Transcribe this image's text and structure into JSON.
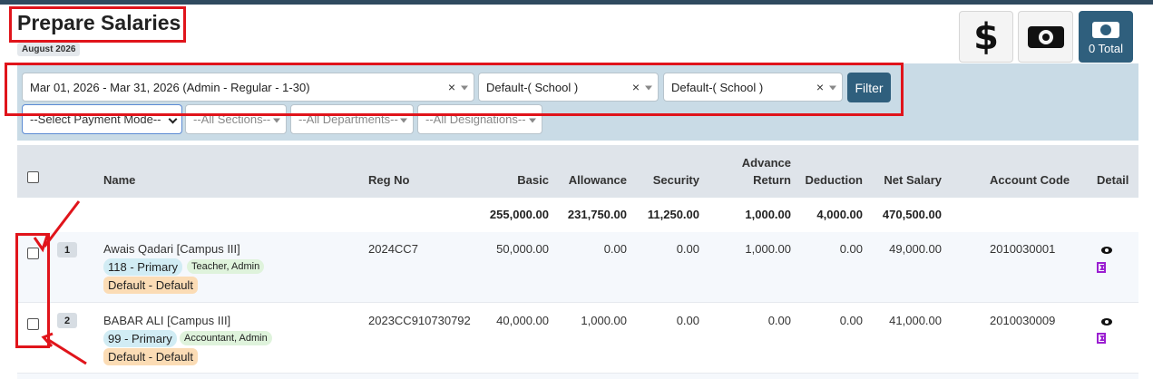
{
  "page": {
    "title": "Prepare Salaries",
    "month": "August 2026"
  },
  "actions": {
    "dollar_icon": "dollar-icon",
    "cash_icon": "cash-icon",
    "total_label": "0 Total"
  },
  "filters": {
    "period": "Mar 01, 2026 - Mar 31, 2026 (Admin - Regular - 1-30)",
    "school1": "Default-( School )",
    "school2": "Default-( School )",
    "filter_button": "Filter",
    "payment_mode": "--Select Payment Mode--",
    "sections": "--All Sections--",
    "departments": "--All Departments--",
    "designations": "--All Designations--",
    "clear_symbol": "×"
  },
  "table": {
    "headers": {
      "name": "Name",
      "reg_no": "Reg No",
      "basic": "Basic",
      "allowance": "Allowance",
      "security": "Security",
      "advance_return_1": "Advance",
      "advance_return_2": "Return",
      "deduction": "Deduction",
      "net_salary": "Net Salary",
      "account_code": "Account Code",
      "detail": "Detail"
    },
    "totals": {
      "basic": "255,000.00",
      "allowance": "231,750.00",
      "security": "11,250.00",
      "advance_return": "1,000.00",
      "deduction": "4,000.00",
      "net_salary": "470,500.00"
    },
    "rows": [
      {
        "index": "1",
        "name": "Awais Qadari [Campus III]",
        "grade": "118 - Primary",
        "roles": "Teacher,  Admin",
        "default": "Default - Default",
        "reg_no": "2024CC7",
        "basic": "50,000.00",
        "allowance": "0.00",
        "security": "0.00",
        "advance_return": "1,000.00",
        "deduction": "0.00",
        "net_salary": "49,000.00",
        "account_code": "2010030001"
      },
      {
        "index": "2",
        "name": "BABAR ALI [Campus III]",
        "grade": "99 - Primary",
        "roles": "Accountant,  Admin",
        "default": "Default - Default",
        "reg_no": "2023CC910730792",
        "basic": "40,000.00",
        "allowance": "1,000.00",
        "security": "0.00",
        "advance_return": "0.00",
        "deduction": "0.00",
        "net_salary": "41,000.00",
        "account_code": "2010030009"
      }
    ]
  },
  "colors": {
    "accent": "#2f5f7d",
    "annotation_red": "#e0141b",
    "filter_panel": "#c9dbe6",
    "header_bg": "#dfe4ea"
  }
}
